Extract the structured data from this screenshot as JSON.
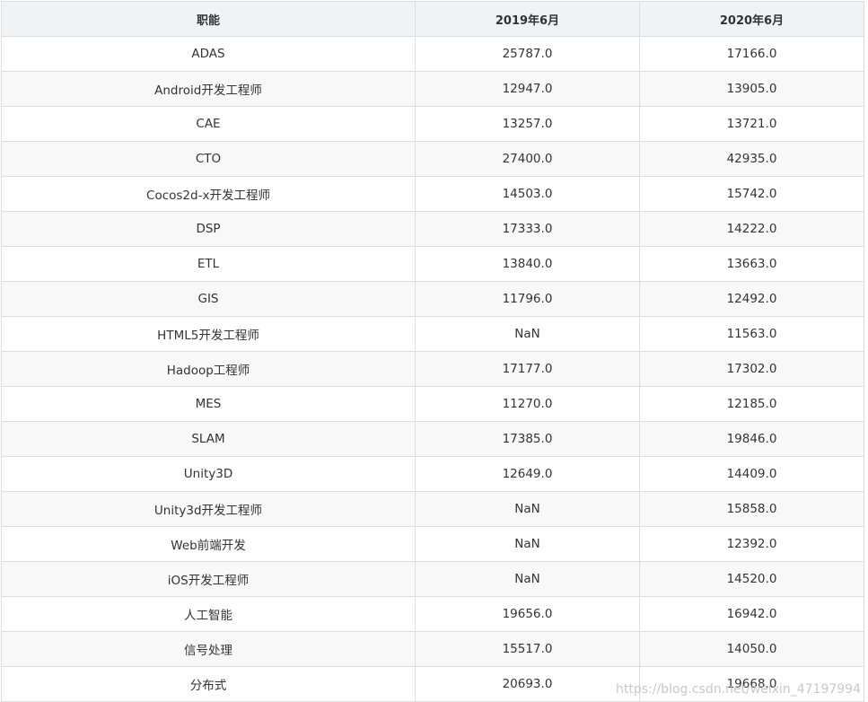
{
  "table": {
    "headers": [
      "职能",
      "2019年6月",
      "2020年6月"
    ],
    "rows": [
      [
        "ADAS",
        "25787.0",
        "17166.0"
      ],
      [
        "Android开发工程师",
        "12947.0",
        "13905.0"
      ],
      [
        "CAE",
        "13257.0",
        "13721.0"
      ],
      [
        "CTO",
        "27400.0",
        "42935.0"
      ],
      [
        "Cocos2d-x开发工程师",
        "14503.0",
        "15742.0"
      ],
      [
        "DSP",
        "17333.0",
        "14222.0"
      ],
      [
        "ETL",
        "13840.0",
        "13663.0"
      ],
      [
        "GIS",
        "11796.0",
        "12492.0"
      ],
      [
        "HTML5开发工程师",
        "NaN",
        "11563.0"
      ],
      [
        "Hadoop工程师",
        "17177.0",
        "17302.0"
      ],
      [
        "MES",
        "11270.0",
        "12185.0"
      ],
      [
        "SLAM",
        "17385.0",
        "19846.0"
      ],
      [
        "Unity3D",
        "12649.0",
        "14409.0"
      ],
      [
        "Unity3d开发工程师",
        "NaN",
        "15858.0"
      ],
      [
        "Web前端开发",
        "NaN",
        "12392.0"
      ],
      [
        "iOS开发工程师",
        "NaN",
        "14520.0"
      ],
      [
        "人工智能",
        "19656.0",
        "16942.0"
      ],
      [
        "信号处理",
        "15517.0",
        "14050.0"
      ],
      [
        "分布式",
        "20693.0",
        "19668.0"
      ]
    ]
  },
  "watermark": "https://blog.csdn.net/weixin_47197994",
  "colors": {
    "header_bg": "#eff3f5",
    "row_alt_bg": "#f8f8f8",
    "border": "#dddddd",
    "text": "#333333"
  }
}
